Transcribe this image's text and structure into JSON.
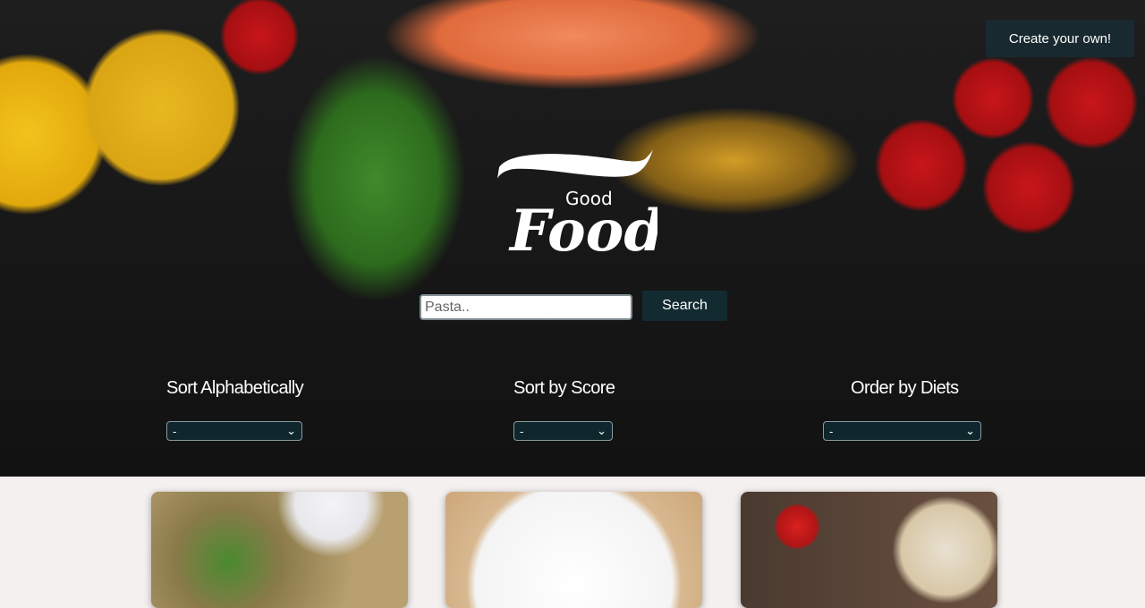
{
  "header": {
    "create_label": "Create your own!",
    "logo_small": "Good",
    "logo_big": "Food"
  },
  "search": {
    "placeholder": "Pasta..",
    "value": "",
    "button_label": "Search"
  },
  "filters": [
    {
      "label": "Sort Alphabetically",
      "selected": "-"
    },
    {
      "label": "Sort by Score",
      "selected": "-"
    },
    {
      "label": "Order by Diets",
      "selected": "-"
    }
  ],
  "cards": [
    {
      "image": "fried-rice-with-greens"
    },
    {
      "image": "fries-plate"
    },
    {
      "image": "strawberry-smoothie"
    }
  ]
}
